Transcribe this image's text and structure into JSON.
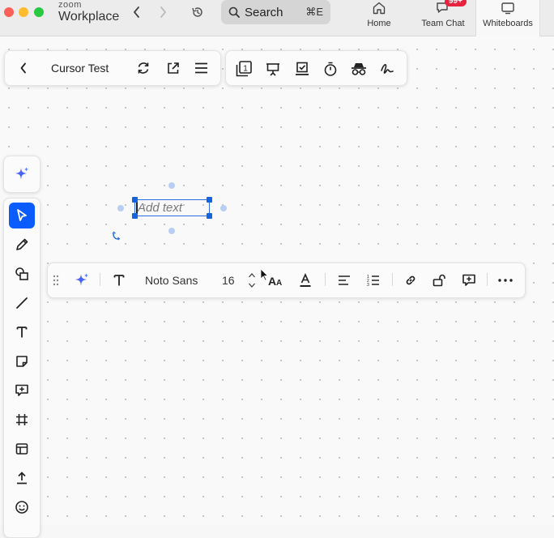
{
  "app": {
    "brand_line1": "zoom",
    "brand_line2": "Workplace",
    "search_label": "Search",
    "search_shortcut": "⌘E",
    "tabs": [
      {
        "label": "Home",
        "icon": "home-icon"
      },
      {
        "label": "Team Chat",
        "icon": "chat-icon",
        "badge": "99+"
      },
      {
        "label": "Whiteboards",
        "icon": "whiteboard-icon",
        "active": true
      }
    ]
  },
  "board": {
    "title": "Cursor Test",
    "header_icons": [
      "back-icon",
      "refresh-icon",
      "share-external-icon",
      "menu-icon"
    ],
    "top_tools": [
      "pages-icon",
      "present-icon",
      "checklist-icon",
      "timer-icon",
      "incognito-icon",
      "signature-icon"
    ],
    "page_number": "1"
  },
  "left_toolbar": [
    "ai-sparkle-icon",
    "select-icon",
    "pen-icon",
    "shapes-icon",
    "line-icon",
    "text-icon",
    "sticky-note-icon",
    "comment-icon",
    "frame-icon",
    "template-icon",
    "upload-icon",
    "emoji-icon"
  ],
  "text_element": {
    "placeholder": "Add text"
  },
  "text_toolbar": {
    "font_name": "Noto Sans",
    "font_size": "16",
    "icons": [
      "drag-handle-icon",
      "ai-sparkle-icon",
      "text-style-icon",
      "font-size-icon",
      "text-color-icon",
      "align-left-icon",
      "list-icon",
      "link-icon",
      "lock-icon",
      "comment-icon",
      "more-icon"
    ]
  },
  "colors": {
    "accent": "#0b5cff",
    "selection": "#1463e0",
    "badge": "#e8233d"
  }
}
